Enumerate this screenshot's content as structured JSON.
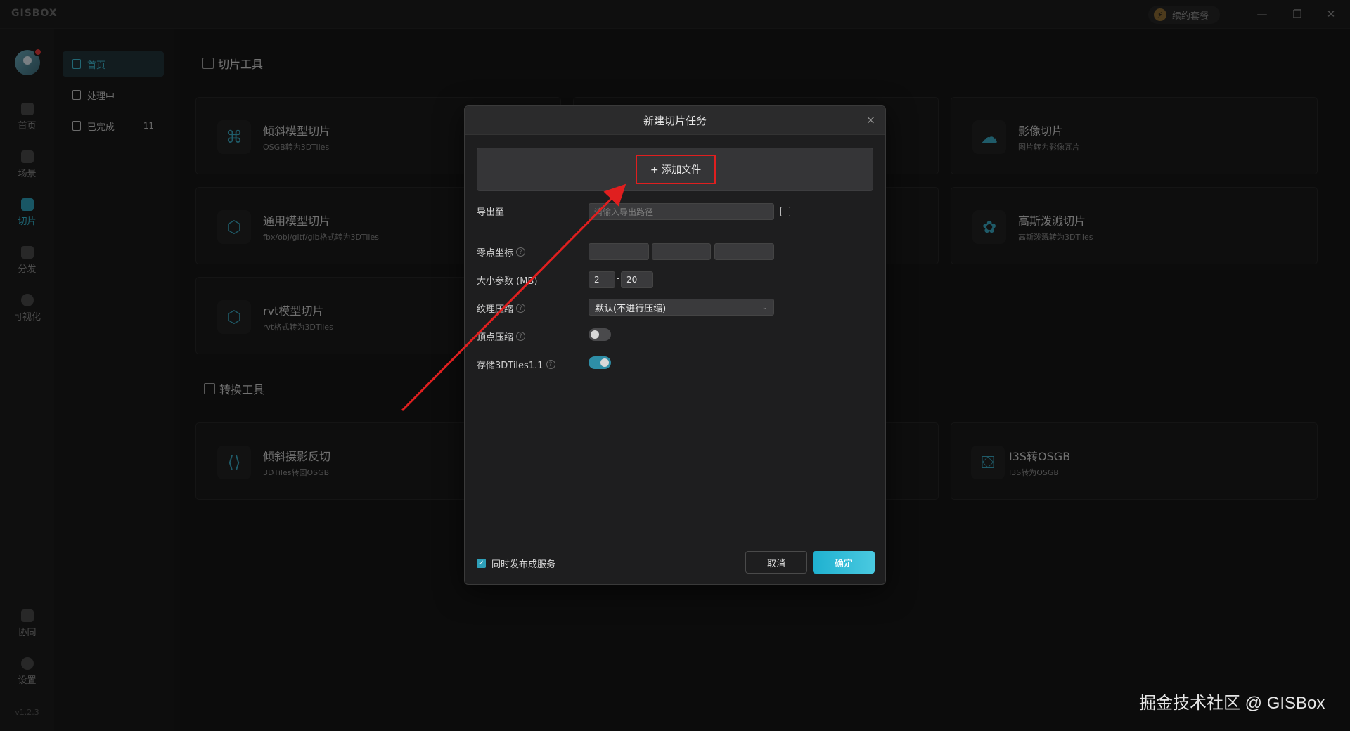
{
  "app": {
    "logo": "GISBOX",
    "renew_label": "续约套餐",
    "renew_icon": "lightning-icon",
    "version": "v1.2.3"
  },
  "rail": {
    "items": [
      {
        "label": "首页",
        "icon": "home-icon"
      },
      {
        "label": "场景",
        "icon": "scene-icon"
      },
      {
        "label": "切片",
        "icon": "tile-icon",
        "active": true
      },
      {
        "label": "分发",
        "icon": "distribute-icon"
      },
      {
        "label": "可视化",
        "icon": "visual-icon"
      }
    ],
    "bottom": [
      {
        "label": "协同",
        "icon": "lock-icon"
      },
      {
        "label": "设置",
        "icon": "gear-icon"
      }
    ]
  },
  "subnav": {
    "items": [
      {
        "label": "首页",
        "active": true
      },
      {
        "label": "处理中"
      },
      {
        "label": "已完成",
        "count": "11"
      }
    ]
  },
  "main": {
    "slice_title": "切片工具",
    "convert_title": "转换工具",
    "cards": [
      {
        "title": "倾斜模型切片",
        "sub": "OSGB转为3DTiles",
        "icon": "drone-icon"
      },
      {
        "title": "影像切片",
        "sub": "图片转为影像瓦片",
        "icon": "cloud-icon"
      },
      {
        "title": "通用模型切片",
        "sub": "fbx/obj/gltf/glb格式转为3DTiles",
        "icon": "cube-icon"
      },
      {
        "title": "高斯泼溅切片",
        "sub": "高斯泼溅转为3DTiles",
        "icon": "splat-icon"
      },
      {
        "title": "rvt模型切片",
        "sub": "rvt格式转为3DTiles",
        "icon": "cube-icon"
      },
      {
        "title": "倾斜摄影反切",
        "sub": "3DTiles转回OSGB",
        "icon": "code-icon"
      },
      {
        "title": "I3S转OSGB",
        "sub": "I3S转为OSGB",
        "icon": "box-icon"
      }
    ]
  },
  "modal": {
    "title": "新建切片任务",
    "close": "×",
    "add_file": "+ 添加文件",
    "export_label": "导出至",
    "export_placeholder": "请输入导出路径",
    "origin_label": "零点坐标",
    "size_label": "大小参数 (MB)",
    "size_min": "2",
    "size_max": "20",
    "size_sep": "-",
    "texture_label": "纹理压缩",
    "texture_value": "默认(不进行压缩)",
    "vertex_label": "顶点压缩",
    "vertex_on": false,
    "store_label": "存储3DTiles1.1",
    "store_on": true,
    "publish_label": "同时发布成服务",
    "publish_checked": true,
    "cancel": "取消",
    "ok": "确定"
  },
  "watermark": "掘金技术社区 @ GISBox",
  "colors": {
    "accent": "#2e9fb8",
    "highlight": "#e01f1f"
  }
}
